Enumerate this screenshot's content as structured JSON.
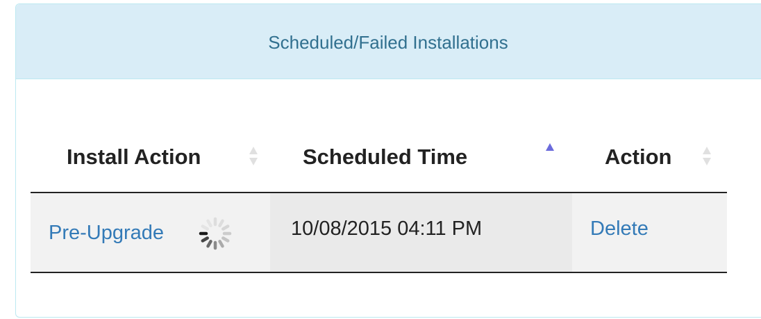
{
  "panel": {
    "title": "Scheduled/Failed Installations"
  },
  "table": {
    "columns": [
      {
        "label": "Install Action",
        "sort_state": "unsorted"
      },
      {
        "label": "Scheduled Time",
        "sort_state": "ascending"
      },
      {
        "label": "Action",
        "sort_state": "unsorted"
      }
    ],
    "rows": [
      {
        "install_action": "Pre-Upgrade",
        "install_action_loading": true,
        "scheduled_time": "10/08/2015 04:11 PM",
        "action": "Delete"
      }
    ]
  },
  "colors": {
    "heading_bg": "#d9edf7",
    "heading_border": "#bce8f1",
    "heading_text": "#31708f",
    "link": "#337ab7",
    "sort_active": "#6b6bdc",
    "sort_inactive": "#e0e0e0"
  },
  "icons": {
    "sort_unsorted": "sort-both-icon",
    "sort_ascending": "sort-up-icon",
    "loading": "spinner-icon"
  }
}
